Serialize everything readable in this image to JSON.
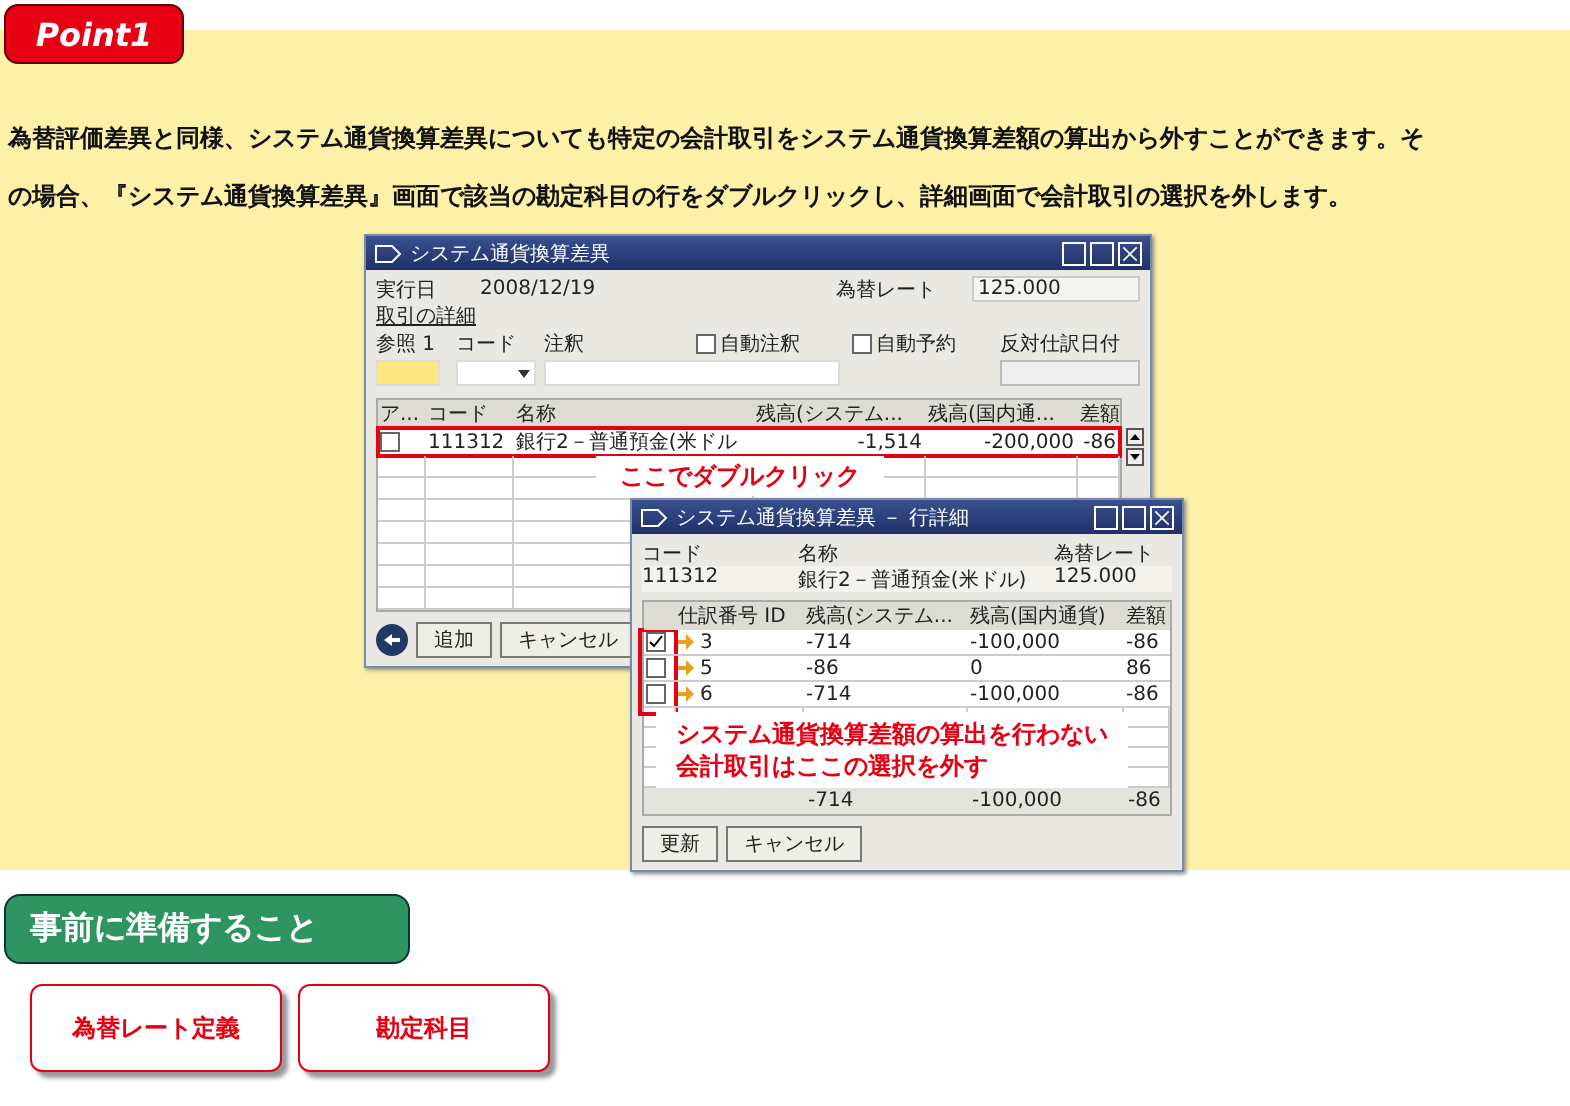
{
  "point_badge": {
    "label": "Point1"
  },
  "paragraph_lines": [
    "為替評価差異と同様、システム通貨換算差異についても特定の会計取引をシステム通貨換算差額の算出から外すことができます。そ",
    "の場合、『システム通貨換算差異』画面で該当の勘定科目の行をダブルクリックし、詳細画面で会計取引の選択を外します。"
  ],
  "main_window": {
    "title": "システム通貨換算差異",
    "exec_date_label": "実行日",
    "exec_date": "2008/12/19",
    "rate_label": "為替レート",
    "rate": "125.000",
    "section_title": "取引の詳細",
    "filters": [
      {
        "kind": "text",
        "label": "参照 1"
      },
      {
        "kind": "text",
        "label": "コード"
      },
      {
        "kind": "text",
        "label": "注釈"
      },
      {
        "kind": "checkbox",
        "label": "自動注釈",
        "checked": false
      },
      {
        "kind": "checkbox",
        "label": "自動予約",
        "checked": false
      },
      {
        "kind": "text",
        "label": "反対仕訳日付"
      }
    ],
    "columns": [
      "ア...",
      "コード",
      "名称",
      "残高(システム...",
      "残高(国内通...",
      "差額"
    ],
    "rows": [
      {
        "checked": false,
        "highlighted": true,
        "code": "111312",
        "name": "銀行2－普通預金(米ドル",
        "balance_system": "-1,514",
        "balance_local": "-200,000",
        "difference": "-86"
      }
    ],
    "buttons": [
      "追加",
      "キャンセル"
    ]
  },
  "callout_1": "ここでダブルクリック",
  "detail_window": {
    "title": "システム通貨換算差異 － 行詳細",
    "labels": [
      "コード",
      "名称",
      "為替レート"
    ],
    "values": [
      "111312",
      "銀行2－普通預金(米ドル)",
      "125.000"
    ],
    "columns": [
      "仕訳番号 ID",
      "残高(システム...",
      "残高(国内通貨)",
      "差額"
    ],
    "rows": [
      {
        "checked": true,
        "id": "3",
        "balance_system": "-714",
        "balance_local": "-100,000",
        "difference": "-86"
      },
      {
        "checked": false,
        "id": "5",
        "balance_system": "-86",
        "balance_local": "0",
        "difference": "86"
      },
      {
        "checked": false,
        "id": "6",
        "balance_system": "-714",
        "balance_local": "-100,000",
        "difference": "-86"
      }
    ],
    "totals": [
      "-714",
      "-100,000",
      "-86"
    ],
    "buttons": [
      "更新",
      "キャンセル"
    ]
  },
  "callout_2": [
    "システム通貨換算差額の算出を行わない",
    "会計取引はここの選択を外す"
  ],
  "prep": {
    "title": "事前に準備すること",
    "links": [
      "為替レート定義",
      "勘定科目"
    ]
  }
}
